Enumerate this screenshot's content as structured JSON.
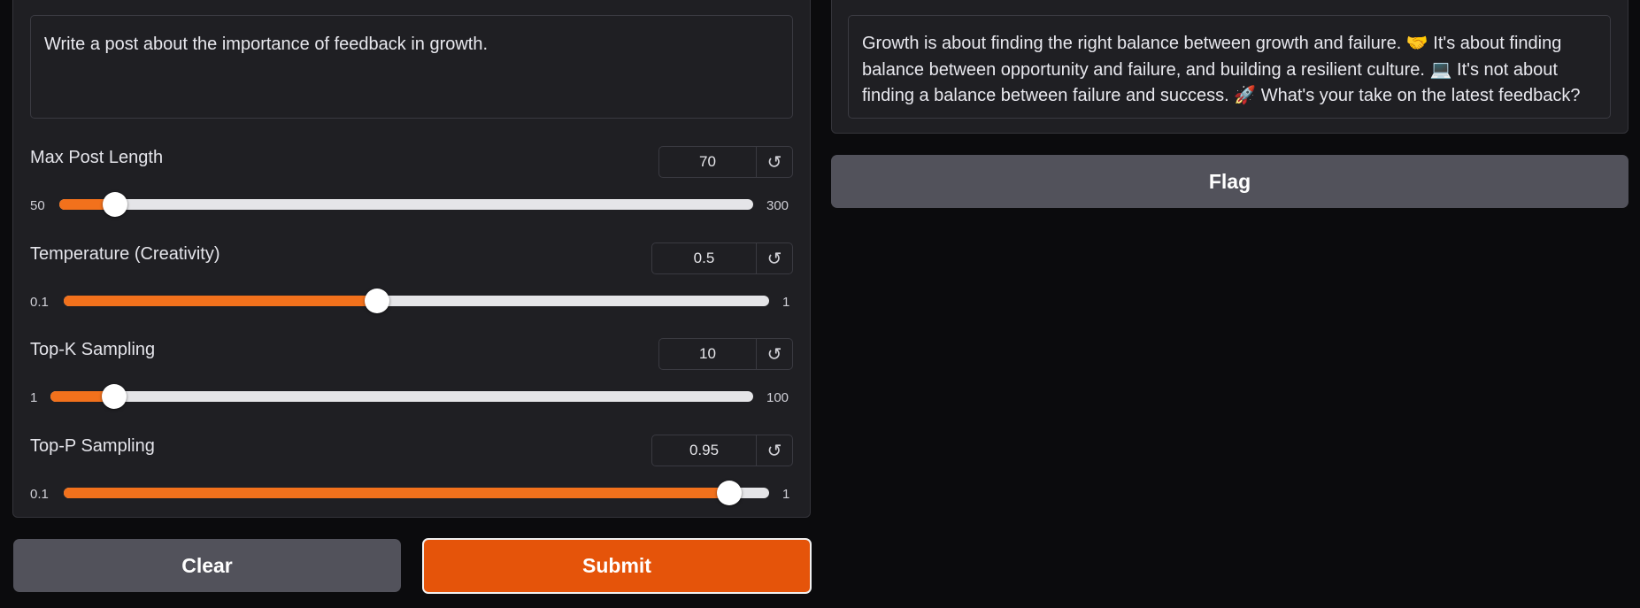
{
  "prompt": {
    "value": "Write a post about the importance of feedback in growth."
  },
  "output": {
    "segments": [
      "Growth is about finding the right balance between growth and failure. ",
      "🤝",
      " It's about finding balance between opportunity and failure, and building a resilient culture. ",
      "💻",
      " It's not about finding a balance between failure and success. ",
      "🚀",
      " What's your take on the latest feedback?"
    ]
  },
  "sliders": [
    {
      "label": "Max Post Length",
      "value": "70",
      "min": "50",
      "max": "300",
      "fraction": 0.08
    },
    {
      "label": "Temperature (Creativity)",
      "value": "0.5",
      "min": "0.1",
      "max": "1",
      "fraction": 0.444
    },
    {
      "label": "Top-K Sampling",
      "value": "10",
      "min": "1",
      "max": "100",
      "fraction": 0.091
    },
    {
      "label": "Top-P Sampling",
      "value": "0.95",
      "min": "0.1",
      "max": "1",
      "fraction": 0.944
    }
  ],
  "reset_icon": "↺",
  "buttons": {
    "clear": "Clear",
    "submit": "Submit",
    "flag": "Flag"
  },
  "colors": {
    "accent": "#f2711c",
    "submit": "#e5540a",
    "secondary_button": "#52525b"
  }
}
